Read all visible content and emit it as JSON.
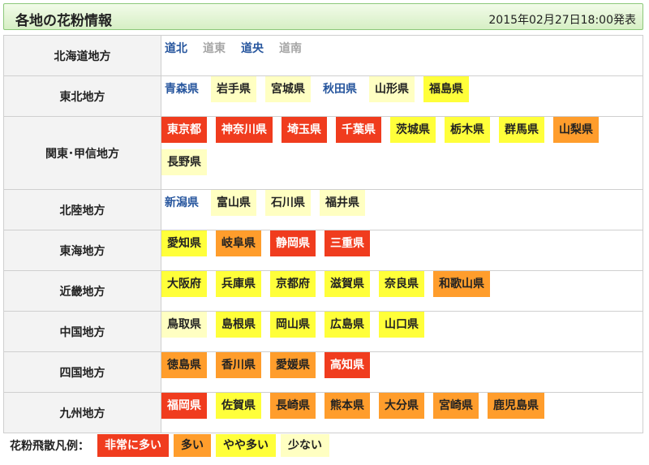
{
  "header": {
    "title": "各地の花粉情報",
    "timestamp": "2015年02月27日18:00発表"
  },
  "regions": [
    {
      "name": "北海道地方",
      "prefs": [
        {
          "name": "道北",
          "level": "link"
        },
        {
          "name": "道東",
          "level": "none"
        },
        {
          "name": "道央",
          "level": "link"
        },
        {
          "name": "道南",
          "level": "none"
        }
      ]
    },
    {
      "name": "東北地方",
      "prefs": [
        {
          "name": "青森県",
          "level": "link"
        },
        {
          "name": "岩手県",
          "level": "low"
        },
        {
          "name": "宮城県",
          "level": "low"
        },
        {
          "name": "秋田県",
          "level": "link"
        },
        {
          "name": "山形県",
          "level": "low"
        },
        {
          "name": "福島県",
          "level": "mid"
        }
      ]
    },
    {
      "name": "関東･甲信地方",
      "prefs": [
        {
          "name": "東京都",
          "level": "vhigh"
        },
        {
          "name": "神奈川県",
          "level": "vhigh"
        },
        {
          "name": "埼玉県",
          "level": "vhigh"
        },
        {
          "name": "千葉県",
          "level": "vhigh"
        },
        {
          "name": "茨城県",
          "level": "mid"
        },
        {
          "name": "栃木県",
          "level": "mid"
        },
        {
          "name": "群馬県",
          "level": "mid"
        },
        {
          "name": "山梨県",
          "level": "high"
        },
        {
          "name": "長野県",
          "level": "low"
        }
      ]
    },
    {
      "name": "北陸地方",
      "prefs": [
        {
          "name": "新潟県",
          "level": "link"
        },
        {
          "name": "富山県",
          "level": "low"
        },
        {
          "name": "石川県",
          "level": "low"
        },
        {
          "name": "福井県",
          "level": "low"
        }
      ]
    },
    {
      "name": "東海地方",
      "prefs": [
        {
          "name": "愛知県",
          "level": "mid"
        },
        {
          "name": "岐阜県",
          "level": "high"
        },
        {
          "name": "静岡県",
          "level": "vhigh"
        },
        {
          "name": "三重県",
          "level": "vhigh"
        }
      ]
    },
    {
      "name": "近畿地方",
      "prefs": [
        {
          "name": "大阪府",
          "level": "mid"
        },
        {
          "name": "兵庫県",
          "level": "mid"
        },
        {
          "name": "京都府",
          "level": "mid"
        },
        {
          "name": "滋賀県",
          "level": "mid"
        },
        {
          "name": "奈良県",
          "level": "mid"
        },
        {
          "name": "和歌山県",
          "level": "high"
        }
      ]
    },
    {
      "name": "中国地方",
      "prefs": [
        {
          "name": "鳥取県",
          "level": "low"
        },
        {
          "name": "島根県",
          "level": "mid"
        },
        {
          "name": "岡山県",
          "level": "mid"
        },
        {
          "name": "広島県",
          "level": "mid"
        },
        {
          "name": "山口県",
          "level": "mid"
        }
      ]
    },
    {
      "name": "四国地方",
      "prefs": [
        {
          "name": "徳島県",
          "level": "high"
        },
        {
          "name": "香川県",
          "level": "high"
        },
        {
          "name": "愛媛県",
          "level": "high"
        },
        {
          "name": "高知県",
          "level": "vhigh"
        }
      ]
    },
    {
      "name": "九州地方",
      "prefs": [
        {
          "name": "福岡県",
          "level": "vhigh"
        },
        {
          "name": "佐賀県",
          "level": "mid"
        },
        {
          "name": "長崎県",
          "level": "high"
        },
        {
          "name": "熊本県",
          "level": "high"
        },
        {
          "name": "大分県",
          "level": "high"
        },
        {
          "name": "宮崎県",
          "level": "high"
        },
        {
          "name": "鹿児島県",
          "level": "high"
        }
      ]
    }
  ],
  "legend": {
    "label": "花粉飛散凡例：",
    "items": [
      {
        "name": "非常に多い",
        "level": "vhigh"
      },
      {
        "name": "多い",
        "level": "high"
      },
      {
        "name": "やや多い",
        "level": "mid"
      },
      {
        "name": "少ない",
        "level": "low"
      }
    ]
  },
  "colors": {
    "vhigh": "#f03c1e",
    "high": "#ff9d2c",
    "mid": "#ffff3a",
    "low": "#ffffc2",
    "link": "#27569e",
    "none": "#a6a6a6",
    "header_bg": "#d6efc4"
  }
}
